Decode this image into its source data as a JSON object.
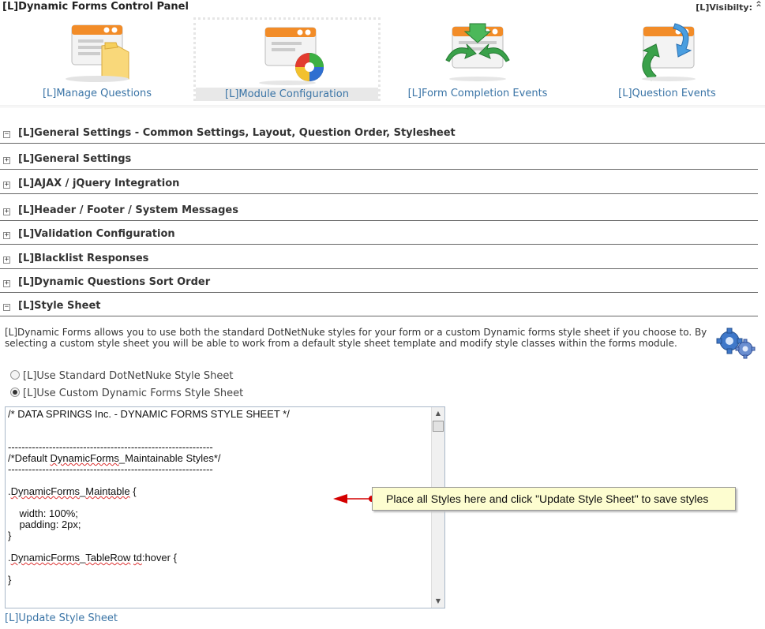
{
  "header": {
    "title": "[L]Dynamic Forms Control Panel",
    "visibility_label": "[L]Visibilty:",
    "collapse_icon": "double-chevron-up-icon"
  },
  "control_panel": {
    "items": [
      {
        "label": "[L]Manage Questions",
        "icon": "manage-questions-icon",
        "selected": false
      },
      {
        "label": "[L]Module Configuration",
        "icon": "module-configuration-icon",
        "selected": true
      },
      {
        "label": "[L]Form Completion Events",
        "icon": "form-completion-events-icon",
        "selected": false
      },
      {
        "label": "[L]Question Events",
        "icon": "question-events-icon",
        "selected": false
      }
    ]
  },
  "sections": {
    "main": {
      "title": "[L]General Settings - Common Settings, Layout, Question Order, Stylesheet",
      "expanded": true
    },
    "items": [
      {
        "title": "[L]General Settings",
        "expanded": false
      },
      {
        "title": "[L]AJAX / jQuery Integration",
        "expanded": false
      },
      {
        "title": "[L]Header / Footer / System Messages",
        "expanded": false
      },
      {
        "title": "[L]Validation Configuration",
        "expanded": false
      },
      {
        "title": "[L]Blacklist Responses",
        "expanded": false
      },
      {
        "title": "[L]Dynamic Questions Sort Order",
        "expanded": false
      },
      {
        "title": "[L]Style Sheet",
        "expanded": true
      }
    ],
    "collapse_symbol": "⊟",
    "expand_symbol": "+",
    "minus_symbol": "−"
  },
  "style_sheet": {
    "description": "[L]Dynamic Forms allows you to use both the standard DotNetNuke styles for your form or a custom Dynamic forms style sheet if you choose to. By selecting a custom style sheet you will be able to work from a default style sheet template and modify style classes within the forms module.",
    "options": [
      {
        "label": "[L]Use Standard DotNetNuke Style Sheet",
        "checked": false
      },
      {
        "label": "[L]Use Custom Dynamic Forms Style Sheet",
        "checked": true
      }
    ],
    "editor_lines": {
      "l1": "/* DATA SPRINGS Inc. - DYNAMIC FORMS STYLE SHEET */",
      "l4": "------------------------------------------------------------",
      "l5a": "/*Default ",
      "l5b": "DynamicForms",
      "l5c": "_Maintainable Styles*/",
      "l6": "------------------------------------------------------------",
      "l8a": ".",
      "l8b": "DynamicForms",
      "l8c": "_",
      "l8d": "Maintable",
      "l8e": " {",
      "l10": "    width: 100%;",
      "l11": "    padding: 2px;",
      "l12": "}",
      "l14a": ".",
      "l14b": "DynamicForms",
      "l14c": "_",
      "l14d": "TableRow",
      "l14e": " ",
      "l14f": "td",
      "l14g": ":hover {",
      "l16": "}"
    },
    "callout": "Place all Styles here and click \"Update Style Sheet\" to save styles",
    "update_link": "[L]Update Style Sheet"
  },
  "colors": {
    "link": "#3a74a6",
    "callout_bg": "#fdfdd0",
    "arrow": "#d40000"
  }
}
